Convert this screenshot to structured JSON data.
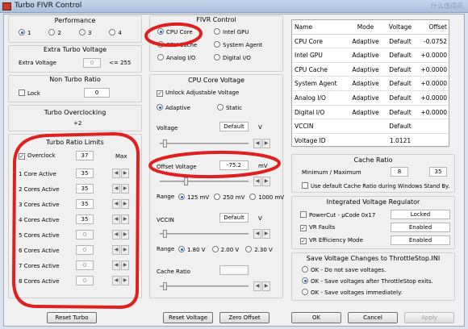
{
  "window": {
    "title": "Turbo FIVR Control",
    "watermark": "什么值得买"
  },
  "performance": {
    "title": "Performance",
    "options": [
      "1",
      "2",
      "3",
      "4"
    ],
    "selected": "1"
  },
  "extra_turbo": {
    "title": "Extra Turbo Voltage",
    "label": "Extra Voltage",
    "value": "0",
    "suffix": "<= 255"
  },
  "non_turbo": {
    "title": "Non Turbo Ratio",
    "lock_label": "Lock",
    "lock_checked": false,
    "value": "0"
  },
  "turbo_overclocking": {
    "title": "Turbo Overclocking",
    "value": "+2"
  },
  "turbo_ratio": {
    "title": "Turbo Ratio Limits",
    "overclock_label": "Overclock",
    "overclock_checked": true,
    "overclock_value": "37",
    "max_label": "Max",
    "rows": [
      {
        "label": "1 Core Active",
        "value": "35",
        "enabled": true
      },
      {
        "label": "2 Cores Active",
        "value": "35",
        "enabled": true
      },
      {
        "label": "3 Cores Active",
        "value": "35",
        "enabled": true
      },
      {
        "label": "4 Cores Active",
        "value": "35",
        "enabled": true
      },
      {
        "label": "5 Cores Active",
        "value": "0",
        "enabled": false
      },
      {
        "label": "6 Cores Active",
        "value": "0",
        "enabled": false
      },
      {
        "label": "7 Cores Active",
        "value": "0",
        "enabled": false
      },
      {
        "label": "8 Cores Active",
        "value": "0",
        "enabled": false
      }
    ]
  },
  "fivr": {
    "title": "FIVR Control",
    "options": [
      {
        "label": "CPU Core",
        "selected": true
      },
      {
        "label": "Intel GPU",
        "selected": false
      },
      {
        "label": "CPU Cache",
        "selected": false
      },
      {
        "label": "System Agent",
        "selected": false
      },
      {
        "label": "Analog I/O",
        "selected": false
      },
      {
        "label": "Digital I/O",
        "selected": false
      }
    ]
  },
  "core_voltage": {
    "title": "CPU Core Voltage",
    "unlock_label": "Unlock Adjustable Voltage",
    "unlock_checked": true,
    "mode_adaptive": "Adaptive",
    "mode_static": "Static",
    "voltage_label": "Voltage",
    "voltage_value": "Default",
    "voltage_unit": "V",
    "offset_label": "Offset Voltage",
    "offset_value": "-75.2",
    "offset_unit": "mV",
    "range_label": "Range",
    "range_options": [
      "125 mV",
      "250 mV",
      "1000 mV"
    ],
    "vccin_label": "VCCIN",
    "vccin_value": "Default",
    "vccin_unit": "V",
    "vccin_range_options": [
      "1.80 V",
      "2.00 V",
      "2.30 V"
    ],
    "cache_ratio_label": "Cache Ratio"
  },
  "voltage_table": {
    "headers": [
      "Name",
      "Mode",
      "Voltage",
      "Offset"
    ],
    "rows": [
      [
        "CPU Core",
        "Adaptive",
        "Default",
        "-0.0752"
      ],
      [
        "Intel GPU",
        "Adaptive",
        "Default",
        "+0.0000"
      ],
      [
        "CPU Cache",
        "Adaptive",
        "Default",
        "+0.0000"
      ],
      [
        "System Agent",
        "Adaptive",
        "Default",
        "+0.0000"
      ],
      [
        "Analog I/O",
        "Adaptive",
        "Default",
        "+0.0000"
      ],
      [
        "Digital I/O",
        "Adaptive",
        "Default",
        "+0.0000"
      ],
      [
        "VCCIN",
        "",
        "Default",
        ""
      ],
      [
        "Voltage ID",
        "",
        "1.0121",
        ""
      ]
    ]
  },
  "cache_ratio": {
    "title": "Cache Ratio",
    "label": "Minimum / Maximum",
    "min": "8",
    "max": "35",
    "default_label": "Use default Cache Ratio during Windows Stand By."
  },
  "ivr": {
    "title": "Integrated Voltage Regulator",
    "items": [
      {
        "label": "PowerCut  -  µCode 0x17",
        "checked": false,
        "status": "Locked"
      },
      {
        "label": "VR Faults",
        "checked": true,
        "status": "Enabled"
      },
      {
        "label": "VR Efficiency Mode",
        "checked": true,
        "status": "Enabled"
      }
    ]
  },
  "save": {
    "title": "Save Voltage Changes to ThrottleStop.INI",
    "options": [
      {
        "label": "OK - Do not save voltages.",
        "selected": false
      },
      {
        "label": "OK - Save voltages after ThrottleStop exits.",
        "selected": true
      },
      {
        "label": "OK - Save voltages immediately.",
        "selected": false
      }
    ]
  },
  "buttons": {
    "reset_turbo": "Reset Turbo",
    "reset_voltage": "Reset Voltage",
    "zero_offset": "Zero Offset",
    "ok": "OK",
    "cancel": "Cancel",
    "apply": "Apply"
  },
  "colors": {
    "annotation": "#e0201f",
    "accent": "#1b62c9"
  }
}
